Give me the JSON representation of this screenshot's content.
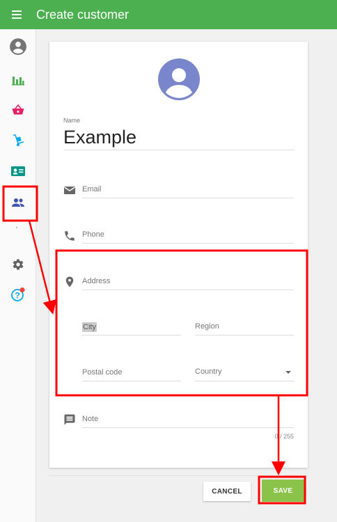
{
  "appbar": {
    "title": "Create customer",
    "menu_icon": "hamburger-menu-icon"
  },
  "sidebar": {
    "items": [
      {
        "name": "account",
        "icon": "account-circle-icon",
        "color": "#757575"
      },
      {
        "name": "reports",
        "icon": "bar-chart-icon",
        "color": "#4caf50"
      },
      {
        "name": "sales",
        "icon": "basket-icon",
        "color": "#e91e63"
      },
      {
        "name": "items",
        "icon": "hand-truck-icon",
        "color": "#03a9f4"
      },
      {
        "name": "employees",
        "icon": "contact-card-icon",
        "color": "#009688"
      },
      {
        "name": "customers",
        "icon": "people-icon",
        "color": "#3f51b5"
      },
      {
        "name": "settings",
        "icon": "gear-icon",
        "color": "#616161"
      },
      {
        "name": "help",
        "icon": "help-icon",
        "color": "#03a9f4"
      }
    ]
  },
  "form": {
    "name_label": "Name",
    "name_value": "Example",
    "email_placeholder": "Email",
    "phone_placeholder": "Phone",
    "address_placeholder": "Address",
    "city_placeholder": "City",
    "region_placeholder": "Region",
    "postal_placeholder": "Postal code",
    "country_label": "Country",
    "note_placeholder": "Note",
    "note_counter": "0 / 255"
  },
  "actions": {
    "cancel_label": "CANCEL",
    "save_label": "SAVE"
  },
  "colors": {
    "appbar": "#4caf50",
    "avatar": "#7986cb",
    "save": "#8bc34a",
    "annotation": "#ff0000"
  }
}
